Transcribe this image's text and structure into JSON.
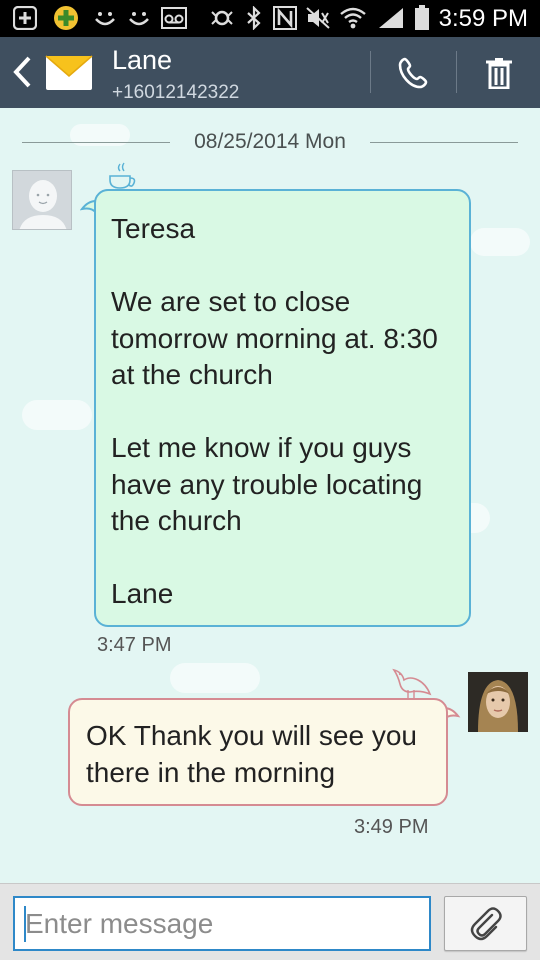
{
  "status_bar": {
    "time": "3:59 PM",
    "icons": [
      "add-icon",
      "app-icon",
      "emoji-icon",
      "emoji-icon",
      "voicemail-icon",
      "vibrate-icon",
      "bluetooth-icon",
      "nfc-icon",
      "muted-icon",
      "wifi-icon",
      "signal-icon",
      "battery-icon"
    ]
  },
  "header": {
    "contact_name": "Lane",
    "contact_number": "+16012142322"
  },
  "conversation": {
    "date_separator": "08/25/2014 Mon",
    "messages": [
      {
        "direction": "incoming",
        "text": "Teresa\n\nWe are set to close tomorrow morning at. 8:30 at the church\n\nLet me know if you guys have any trouble locating the church\n\nLane",
        "time": "3:47 PM"
      },
      {
        "direction": "outgoing",
        "text": "OK Thank you will see you there in the morning",
        "time": "3:49 PM"
      }
    ]
  },
  "input": {
    "placeholder": "Enter message",
    "value": ""
  },
  "colors": {
    "header_bg": "#3f4f5f",
    "conversation_bg": "#e3f6f3",
    "incoming_bubble_bg": "#d9f9e4",
    "incoming_bubble_border": "#5ab2d6",
    "outgoing_bubble_bg": "#fcf9e8",
    "outgoing_bubble_border": "#d58b92",
    "input_border": "#2e88c8"
  }
}
